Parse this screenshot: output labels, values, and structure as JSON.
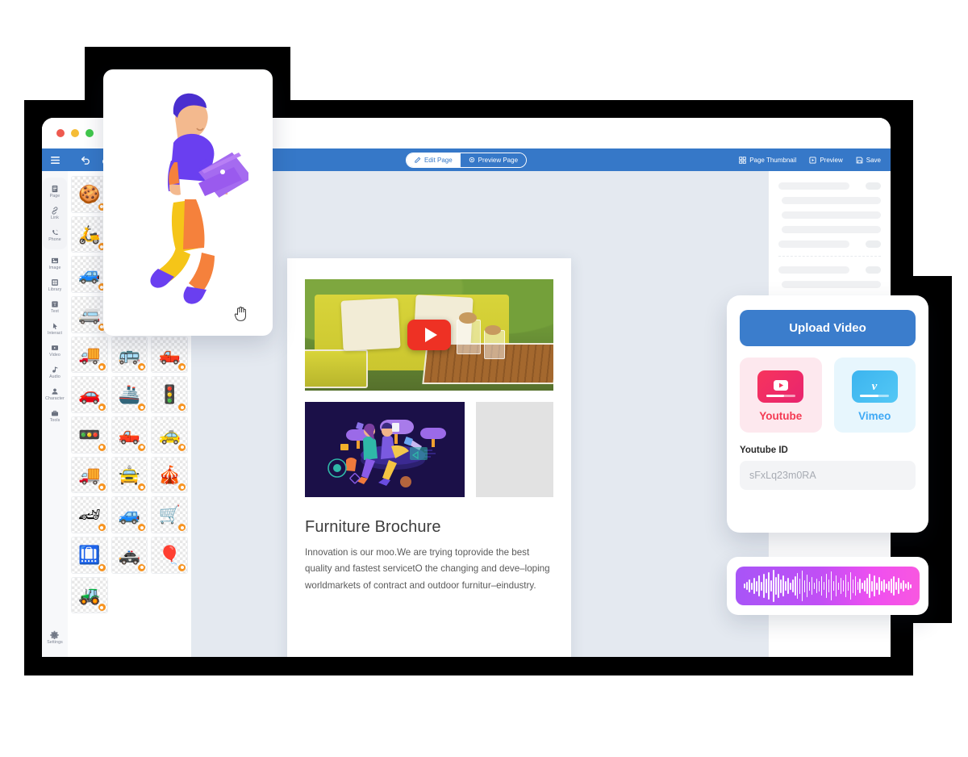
{
  "window": {
    "traffic_lights": [
      "red",
      "yellow",
      "green"
    ]
  },
  "toolbar": {
    "menu_icon": "hamburger-menu-icon",
    "undo_icon": "undo-icon",
    "redo_icon": "redo-icon",
    "segment": [
      {
        "label": "Edit Page",
        "icon": "edit-pencil-icon",
        "active": false
      },
      {
        "label": "Preview Page",
        "icon": "preview-eye-icon",
        "active": true
      }
    ],
    "actions": [
      {
        "label": "Page Thumbnail",
        "icon": "thumbnail-grid-icon"
      },
      {
        "label": "Preview",
        "icon": "preview-play-icon"
      },
      {
        "label": "Save",
        "icon": "save-disk-icon"
      }
    ]
  },
  "sidebar": {
    "items": [
      {
        "label": "Page",
        "icon": "page-icon"
      },
      {
        "label": "Link",
        "icon": "link-icon"
      },
      {
        "label": "Phone",
        "icon": "phone-icon"
      },
      {
        "label": "Image",
        "icon": "image-icon"
      },
      {
        "label": "Library",
        "icon": "library-grid-icon"
      },
      {
        "label": "Text",
        "icon": "text-icon"
      },
      {
        "label": "Interact",
        "icon": "interact-cursor-icon"
      },
      {
        "label": "Video",
        "icon": "video-icon"
      },
      {
        "label": "Audio",
        "icon": "audio-note-icon"
      },
      {
        "label": "Character",
        "icon": "character-person-icon"
      },
      {
        "label": "Tools",
        "icon": "tools-toolbox-icon"
      }
    ],
    "settings": {
      "label": "Settings",
      "icon": "gear-icon"
    }
  },
  "asset_grid": {
    "assets": [
      {
        "name": "cookie-sprinkles",
        "glyph": "🍪"
      },
      {
        "name": "sand-pile",
        "glyph": "⛰"
      },
      {
        "name": "red-circle",
        "glyph": "🔴"
      },
      {
        "name": "scooter-blue",
        "glyph": "🛵"
      },
      {
        "name": "sedan-tan",
        "glyph": "🚘"
      },
      {
        "name": "tractor-red",
        "glyph": "🚜"
      },
      {
        "name": "suv-gray",
        "glyph": "🚙"
      },
      {
        "name": "police-car",
        "glyph": "🚓"
      },
      {
        "name": "ambulance",
        "glyph": "🚑"
      },
      {
        "name": "van-orange",
        "glyph": "🚐"
      },
      {
        "name": "train-blue",
        "glyph": "🚄"
      },
      {
        "name": "motorbike-rider",
        "glyph": "🏍"
      },
      {
        "name": "delivery-truck",
        "glyph": "🚚"
      },
      {
        "name": "school-bus",
        "glyph": "🚌"
      },
      {
        "name": "flatbed-truck",
        "glyph": "🛻"
      },
      {
        "name": "car-blue",
        "glyph": "🚗"
      },
      {
        "name": "container-ship",
        "glyph": "🚢"
      },
      {
        "name": "traffic-light-a",
        "glyph": "🚦"
      },
      {
        "name": "traffic-light-b",
        "glyph": "🚥"
      },
      {
        "name": "pickup-blue",
        "glyph": "🛻"
      },
      {
        "name": "car-pink",
        "glyph": "🚕"
      },
      {
        "name": "truck-orange",
        "glyph": "🚚"
      },
      {
        "name": "vintage-car-blue",
        "glyph": "🚖"
      },
      {
        "name": "food-cart",
        "glyph": "🎪"
      },
      {
        "name": "race-car-red",
        "glyph": "🏎"
      },
      {
        "name": "jeep-green",
        "glyph": "🚙"
      },
      {
        "name": "hand-cart",
        "glyph": "🛒"
      },
      {
        "name": "luggage-cart",
        "glyph": "🛄"
      },
      {
        "name": "police-car-front",
        "glyph": "🚓"
      },
      {
        "name": "hot-air-balloon",
        "glyph": "🎈"
      },
      {
        "name": "army-tank",
        "glyph": "🚜"
      }
    ]
  },
  "document": {
    "title": "Furniture Brochure",
    "body": "Innovation is our moo.We are trying toprovide the best quality and fastest servicetO the changing and deve–loping worldmarkets of contract and outdoor furnitur–eindustry.",
    "hero_image": "outdoor-furniture-photo",
    "hero_play_icon": "youtube-play-button",
    "illustration_image": "cloud-collaboration-illustration",
    "placeholder_image": "empty-image-placeholder"
  },
  "video_panel": {
    "upload_label": "Upload Video",
    "sources": [
      {
        "label": "Youtube",
        "icon": "youtube-icon",
        "color": "#f43a53"
      },
      {
        "label": "Vimeo",
        "icon": "vimeo-icon",
        "color": "#3fa9f5"
      }
    ],
    "field_label": "Youtube ID",
    "field_value": "sFxLq23m0RA"
  },
  "audio_card": {
    "waveform_icon": "audio-waveform",
    "gradient_start": "#a855f7",
    "gradient_end": "#f857e0"
  },
  "illustration_card": {
    "image": "man-with-laptop-illustration",
    "cursor": "grab-hand-cursor"
  },
  "colors": {
    "toolbar_blue": "#3678c8",
    "canvas_bg": "#e4e9f0",
    "accent_button": "#3b7dcc",
    "badge_orange": "#f79421"
  }
}
